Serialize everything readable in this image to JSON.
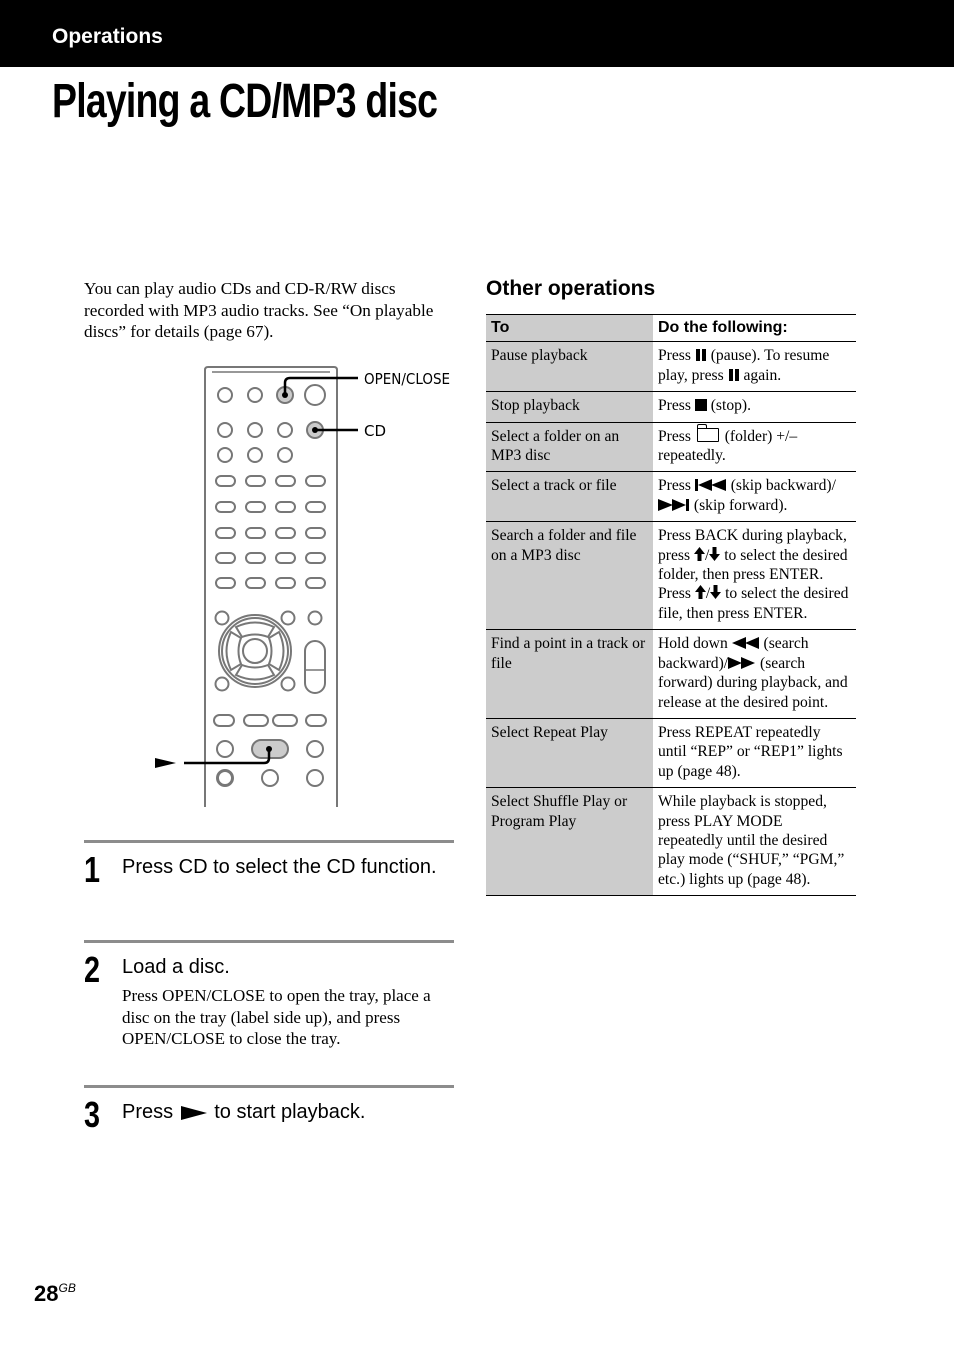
{
  "header": {
    "section": "Operations"
  },
  "page_title": "Playing a CD/MP3 disc",
  "intro": "You can play audio CDs and CD-R/RW discs recorded with MP3 audio tracks. See “On playable discs” for details (page 67).",
  "figure": {
    "callouts": {
      "open_close": "OPEN/CLOSE",
      "cd": "CD"
    },
    "play_marker_icon": "play-triangle"
  },
  "steps": [
    {
      "number": "1",
      "heading": "Press CD to select the CD function.",
      "body": ""
    },
    {
      "number": "2",
      "heading": "Load a disc.",
      "body": "Press OPEN/CLOSE to open the tray, place a disc on the tray (label side up), and press OPEN/CLOSE to close the tray."
    },
    {
      "number": "3",
      "heading_before": "Press",
      "heading_after": "to start playback."
    }
  ],
  "other_operations": {
    "title": "Other operations",
    "columns": [
      "To",
      "Do the following:"
    ],
    "rows": [
      {
        "to": "Pause playback",
        "parts": [
          "Press ",
          "(pause). To resume play, press ",
          "again."
        ]
      },
      {
        "to": "Stop playback",
        "parts": [
          "Press ",
          "(stop)."
        ]
      },
      {
        "to": "Select a folder on an MP3 disc",
        "parts": [
          "Press ",
          "(folder) +/– repeatedly."
        ]
      },
      {
        "to": "Select a track or file",
        "parts": [
          "Press ",
          " (skip backward)/",
          " (skip forward)."
        ]
      },
      {
        "to": "Search a folder and file on a MP3 disc",
        "parts": [
          "Press BACK during playback, press ",
          "/",
          " to select the desired folder, then press ENTER. Press ",
          "/",
          " to select the desired file, then press ENTER."
        ]
      },
      {
        "to": "Find a point in a track or file",
        "parts": [
          "Hold down ",
          " (search backward)/",
          " (search forward) during playback, and release at the desired point."
        ]
      },
      {
        "to": "Select Repeat Play",
        "parts": [
          "Press REPEAT repeatedly until “REP” or “REP1” lights up (page 48)."
        ]
      },
      {
        "to": "Select Shuffle Play or Program Play",
        "parts": [
          "While playback is stopped, press PLAY MODE repeatedly until the desired play mode (“SHUF,” “PGM,” etc.) lights up (page 48)."
        ]
      }
    ]
  },
  "footer": {
    "page_number": "28",
    "page_suffix": "GB"
  }
}
